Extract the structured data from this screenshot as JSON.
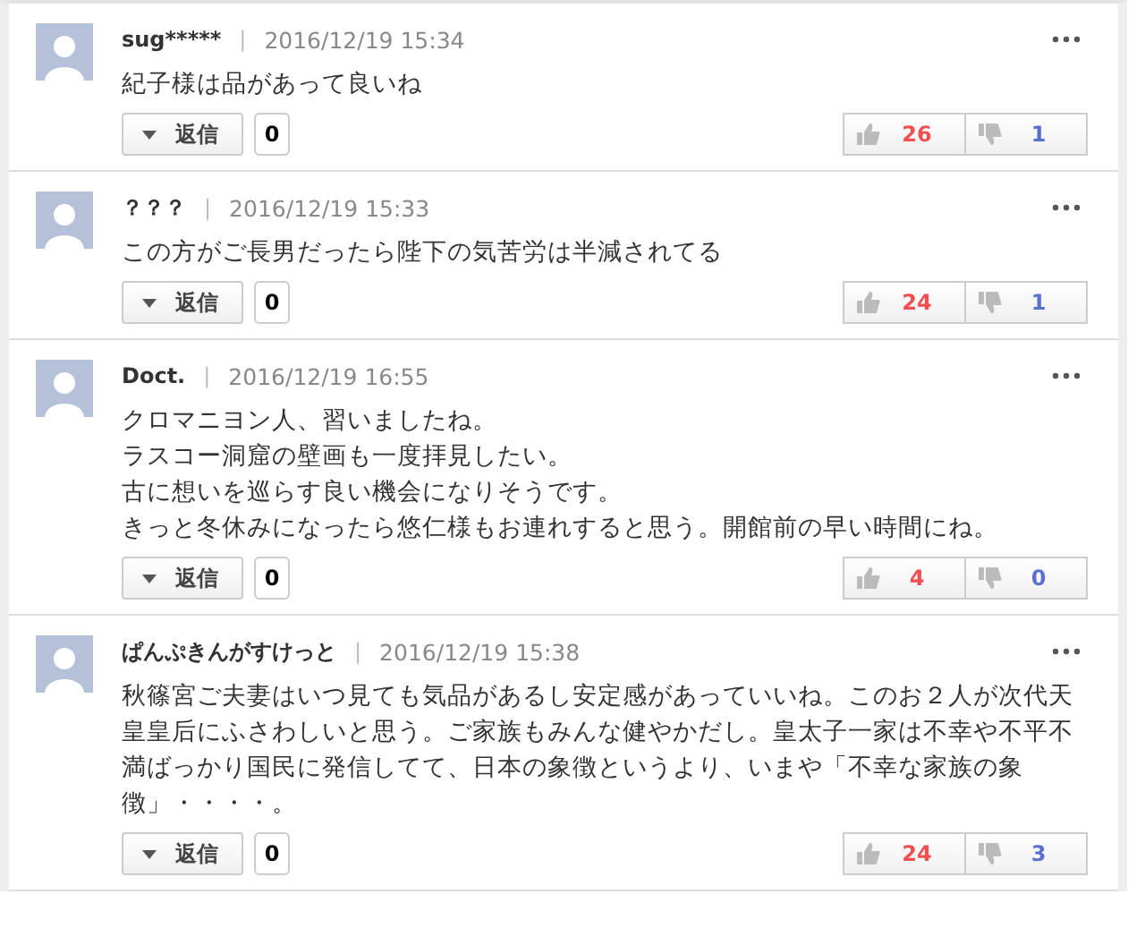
{
  "comments": [
    {
      "user": "sug*****",
      "separator": "|",
      "time": "2016/12/19 15:34",
      "lines": [
        "紀子様は品があって良いね"
      ],
      "reply_label": "返信",
      "reply_count": "0",
      "likes": "26",
      "dislikes": "1"
    },
    {
      "user": "？？？",
      "separator": "|",
      "time": "2016/12/19 15:33",
      "lines": [
        "この方がご長男だったら陛下の気苦労は半減されてる"
      ],
      "reply_label": "返信",
      "reply_count": "0",
      "likes": "24",
      "dislikes": "1"
    },
    {
      "user": "Doct.",
      "separator": "|",
      "time": "2016/12/19 16:55",
      "lines": [
        "クロマニヨン人、習いましたね。",
        "ラスコー洞窟の壁画も一度拝見したい。",
        "古に想いを巡らす良い機会になりそうです。",
        "きっと冬休みになったら悠仁様もお連れすると思う。開館前の早い時間にね。"
      ],
      "reply_label": "返信",
      "reply_count": "0",
      "likes": "4",
      "dislikes": "0"
    },
    {
      "user": "ぱんぷきんがすけっと",
      "separator": "|",
      "time": "2016/12/19 15:38",
      "lines": [
        "秋篠宮ご夫妻はいつ見ても気品があるし安定感があっていいね。このお２人が次代天皇皇后にふさわしいと思う。ご家族もみんな健やかだし。皇太子一家は不幸や不平不満ばっかり国民に発信してて、日本の象徴というより、いまや「不幸な家族の象徴」・・・・。"
      ],
      "reply_label": "返信",
      "reply_count": "0",
      "likes": "24",
      "dislikes": "3"
    }
  ]
}
